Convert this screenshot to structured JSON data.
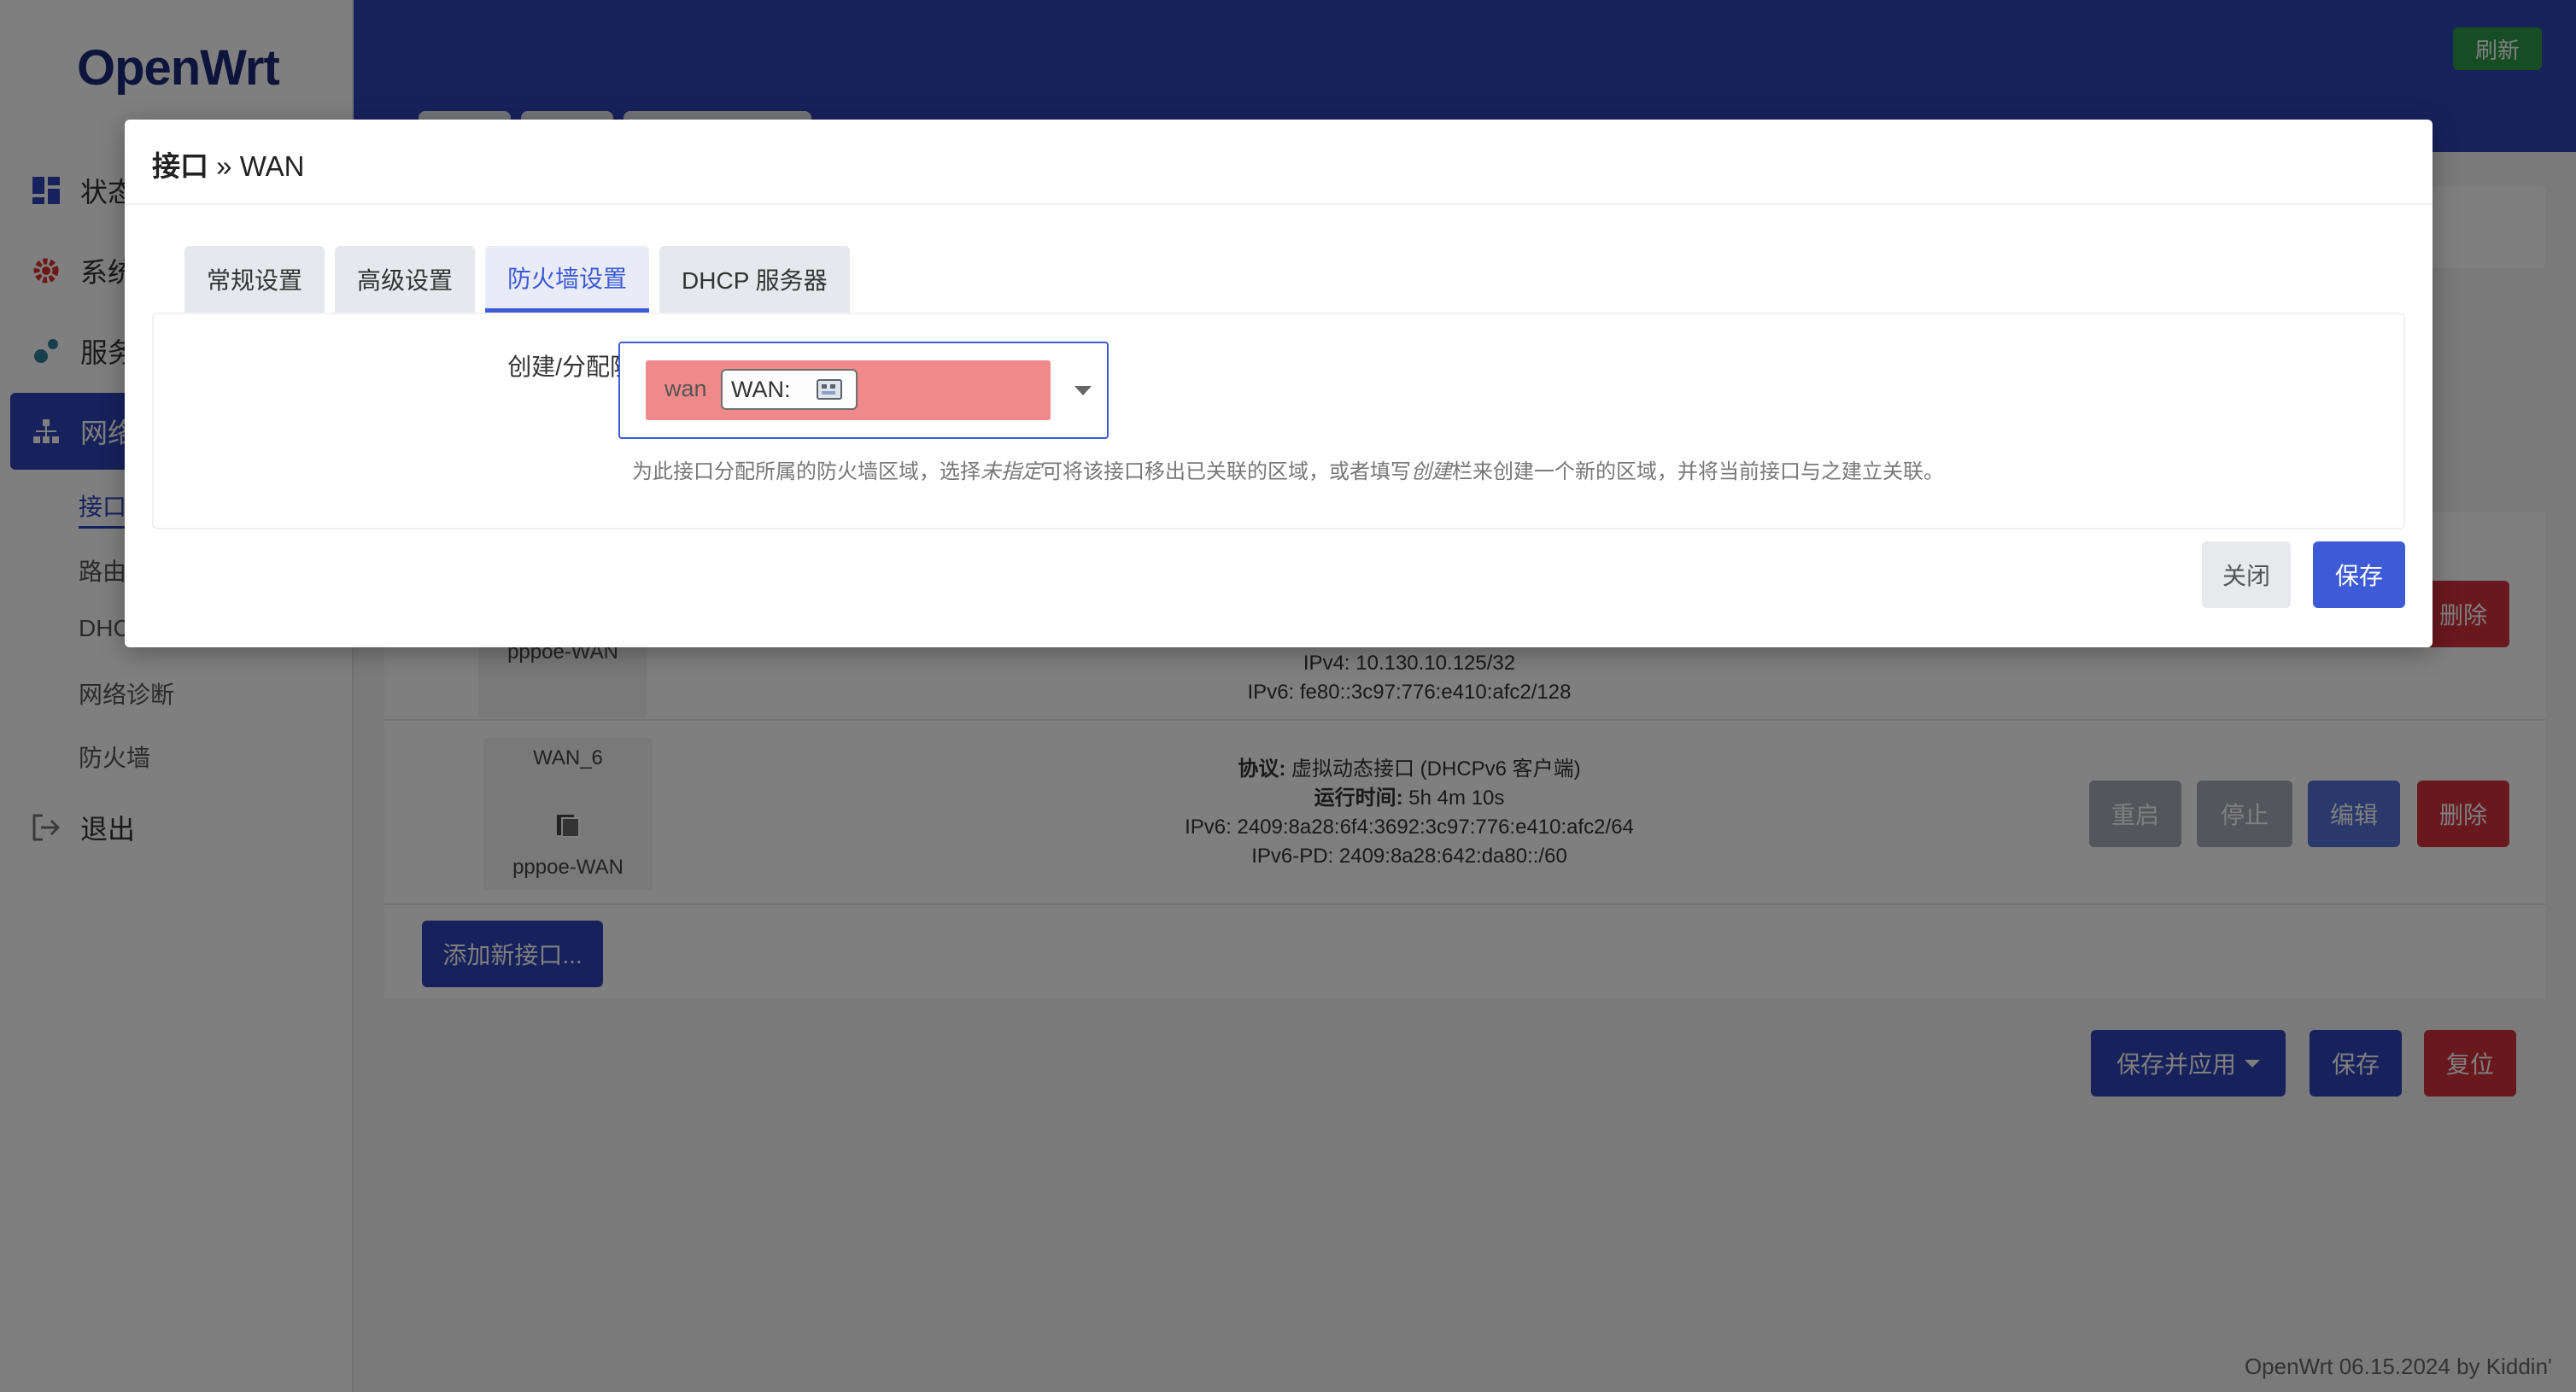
{
  "app": {
    "logo": "OpenWrt",
    "refresh_label": "刷新",
    "footer": "OpenWrt 06.15.2024 by Kiddin'"
  },
  "sidebar": {
    "items": [
      {
        "label": "状态",
        "icon": "dashboard-icon"
      },
      {
        "label": "系统",
        "icon": "gear-icon"
      },
      {
        "label": "服务",
        "icon": "services-icon"
      },
      {
        "label": "网络",
        "icon": "network-icon"
      }
    ],
    "network_subitems": [
      "接口",
      "路由",
      "DHCP/DNS",
      "网络诊断",
      "防火墙"
    ],
    "logout_label": "退出"
  },
  "interfaces": [
    {
      "device": "pppoe-WAN",
      "ipv4": "IPv4: 10.130.10.125/32",
      "ipv6": "IPv6: fe80::3c97:776:e410:afc2/128"
    },
    {
      "name": "WAN_6",
      "device": "pppoe-WAN",
      "protocol_label": "协议:",
      "protocol": "虚拟动态接口 (DHCPv6 客户端)",
      "uptime_label": "运行时间:",
      "uptime": "5h 4m 10s",
      "ipv6": "IPv6: 2409:8a28:6f4:3692:3c97:776:e410:afc2/64",
      "ipv6pd": "IPv6-PD: 2409:8a28:642:da80::/60"
    }
  ],
  "row_buttons": {
    "restart": "重启",
    "stop": "停止",
    "edit": "编辑",
    "delete": "删除"
  },
  "add_interface_label": "添加新接口...",
  "page_actions": {
    "save_apply": "保存并应用",
    "save": "保存",
    "reset": "复位"
  },
  "modal": {
    "title_prefix": "接口",
    "title_sep": " » ",
    "title_name": "WAN",
    "tabs": [
      "常规设置",
      "高级设置",
      "防火墙设置",
      "DHCP 服务器"
    ],
    "active_tab": "防火墙设置",
    "field_label": "创建/分配防火墙区域",
    "zone_name": "wan",
    "zone_badge": "WAN:",
    "zone_color": "#f08a8a",
    "help_part1": "为此接口分配所属的防火墙区域，选择",
    "help_em1": "未指定",
    "help_part2": "可将该接口移出已关联的区域，或者填写",
    "help_em2": "创建",
    "help_part3": "栏来创建一个新的区域，并将当前接口与之建立关联。",
    "close_label": "关闭",
    "save_label": "保存"
  }
}
